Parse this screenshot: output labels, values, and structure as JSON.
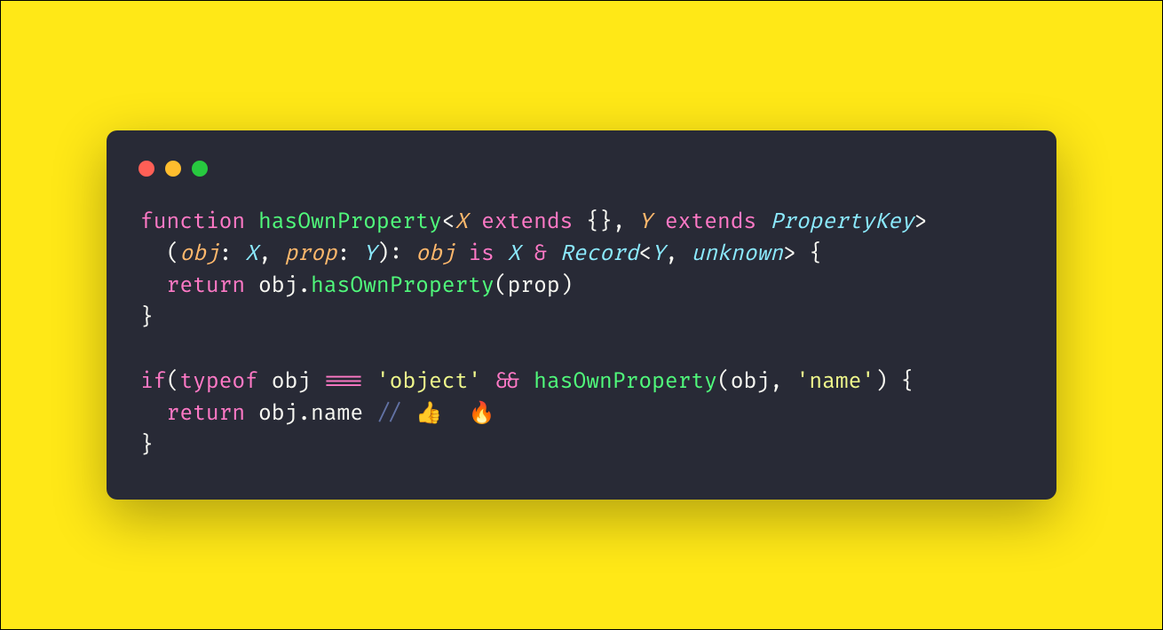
{
  "colors": {
    "background": "#ffe817",
    "window_bg": "#282a36",
    "traffic_red": "#ff5f56",
    "traffic_yellow": "#ffbd2e",
    "traffic_green": "#27c93f",
    "keyword": "#ff79c6",
    "function": "#50fa7b",
    "type": "#8be9fd",
    "param": "#ffb86c",
    "punct": "#f8f8f2",
    "string": "#f1fa8c",
    "comment": "#6272a4"
  },
  "code": {
    "lines": [
      [
        {
          "t": "function",
          "c": "keyword"
        },
        {
          "t": " ",
          "c": "punct"
        },
        {
          "t": "hasOwnProperty",
          "c": "func"
        },
        {
          "t": "<",
          "c": "punct"
        },
        {
          "t": "X",
          "c": "param"
        },
        {
          "t": " ",
          "c": "punct"
        },
        {
          "t": "extends",
          "c": "keyword"
        },
        {
          "t": " ",
          "c": "punct"
        },
        {
          "t": "{}",
          "c": "brace"
        },
        {
          "t": ", ",
          "c": "punct"
        },
        {
          "t": "Y",
          "c": "param"
        },
        {
          "t": " ",
          "c": "punct"
        },
        {
          "t": "extends",
          "c": "keyword"
        },
        {
          "t": " ",
          "c": "punct"
        },
        {
          "t": "PropertyKey",
          "c": "type"
        },
        {
          "t": ">",
          "c": "punct"
        }
      ],
      [
        {
          "t": "  (",
          "c": "punct"
        },
        {
          "t": "obj",
          "c": "param"
        },
        {
          "t": ": ",
          "c": "punct"
        },
        {
          "t": "X",
          "c": "type"
        },
        {
          "t": ", ",
          "c": "punct"
        },
        {
          "t": "prop",
          "c": "param"
        },
        {
          "t": ": ",
          "c": "punct"
        },
        {
          "t": "Y",
          "c": "type"
        },
        {
          "t": "): ",
          "c": "punct"
        },
        {
          "t": "obj",
          "c": "param"
        },
        {
          "t": " ",
          "c": "punct"
        },
        {
          "t": "is",
          "c": "oper"
        },
        {
          "t": " ",
          "c": "punct"
        },
        {
          "t": "X",
          "c": "type"
        },
        {
          "t": " ",
          "c": "punct"
        },
        {
          "t": "&",
          "c": "oper"
        },
        {
          "t": " ",
          "c": "punct"
        },
        {
          "t": "Record",
          "c": "type"
        },
        {
          "t": "<",
          "c": "punct"
        },
        {
          "t": "Y",
          "c": "type"
        },
        {
          "t": ", ",
          "c": "punct"
        },
        {
          "t": "unknown",
          "c": "type"
        },
        {
          "t": ">",
          "c": "punct"
        },
        {
          "t": " {",
          "c": "brace"
        }
      ],
      [
        {
          "t": "  ",
          "c": "punct"
        },
        {
          "t": "return",
          "c": "keyword"
        },
        {
          "t": " obj.",
          "c": "punct"
        },
        {
          "t": "hasOwnProperty",
          "c": "propfn"
        },
        {
          "t": "(prop)",
          "c": "punct"
        }
      ],
      [
        {
          "t": "}",
          "c": "brace"
        }
      ],
      [
        {
          "t": "",
          "c": "punct"
        }
      ],
      [
        {
          "t": "if",
          "c": "keyword"
        },
        {
          "t": "(",
          "c": "punct"
        },
        {
          "t": "typeof",
          "c": "keyword"
        },
        {
          "t": " obj ",
          "c": "punct"
        },
        {
          "t": "===",
          "c": "oper"
        },
        {
          "t": " ",
          "c": "punct"
        },
        {
          "t": "'object'",
          "c": "string"
        },
        {
          "t": " ",
          "c": "punct"
        },
        {
          "t": "&&",
          "c": "oper"
        },
        {
          "t": " ",
          "c": "punct"
        },
        {
          "t": "hasOwnProperty",
          "c": "func"
        },
        {
          "t": "(obj, ",
          "c": "punct"
        },
        {
          "t": "'name'",
          "c": "string"
        },
        {
          "t": ") {",
          "c": "punct"
        }
      ],
      [
        {
          "t": "  ",
          "c": "punct"
        },
        {
          "t": "return",
          "c": "keyword"
        },
        {
          "t": " obj.name ",
          "c": "punct"
        },
        {
          "t": "// 👍  🔥",
          "c": "comment"
        }
      ],
      [
        {
          "t": "}",
          "c": "brace"
        }
      ]
    ]
  }
}
